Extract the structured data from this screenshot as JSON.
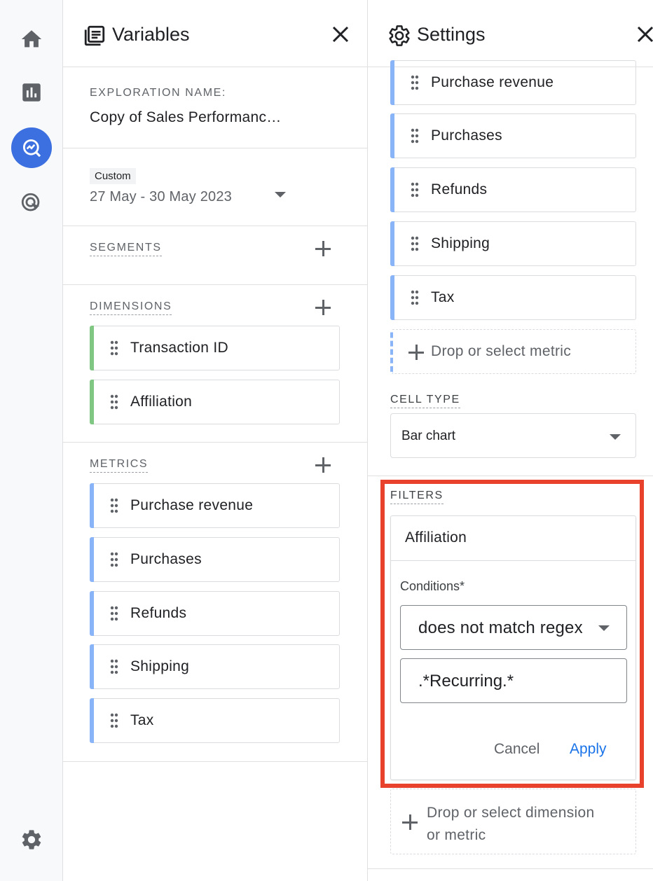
{
  "rail": {
    "items": [
      {
        "name": "home-icon"
      },
      {
        "name": "reports-icon"
      },
      {
        "name": "explore-icon",
        "active": true
      },
      {
        "name": "advertising-icon"
      }
    ],
    "settings_icon": "gear-icon"
  },
  "variables": {
    "title": "Variables",
    "exploration_name_label": "EXPLORATION NAME:",
    "exploration_name": "Copy of Sales Performanc…",
    "date_badge": "Custom",
    "date_range": "27 May - 30 May 2023",
    "segments_label": "SEGMENTS",
    "dimensions_label": "DIMENSIONS",
    "dimensions": [
      "Transaction ID",
      "Affiliation"
    ],
    "metrics_label": "METRICS",
    "metrics": [
      "Purchase revenue",
      "Purchases",
      "Refunds",
      "Shipping",
      "Tax"
    ]
  },
  "settings": {
    "title": "Settings",
    "values": [
      "Purchase revenue",
      "Purchases",
      "Refunds",
      "Shipping",
      "Tax"
    ],
    "drop_metric": "Drop or select metric",
    "cell_type_label": "CELL TYPE",
    "cell_type_value": "Bar chart",
    "filters_label": "FILTERS",
    "filter": {
      "dimension": "Affiliation",
      "conditions_label": "Conditions*",
      "condition": "does not match regex",
      "value": ".*Recurring.*",
      "cancel": "Cancel",
      "apply": "Apply"
    },
    "drop_filter_line1": "Drop or select dimension",
    "drop_filter_line2": "or metric"
  },
  "colors": {
    "accent": "#1a73e8",
    "highlight": "#e8412c",
    "dimension_bar": "#81c784",
    "metric_bar": "#8ab4f8"
  }
}
